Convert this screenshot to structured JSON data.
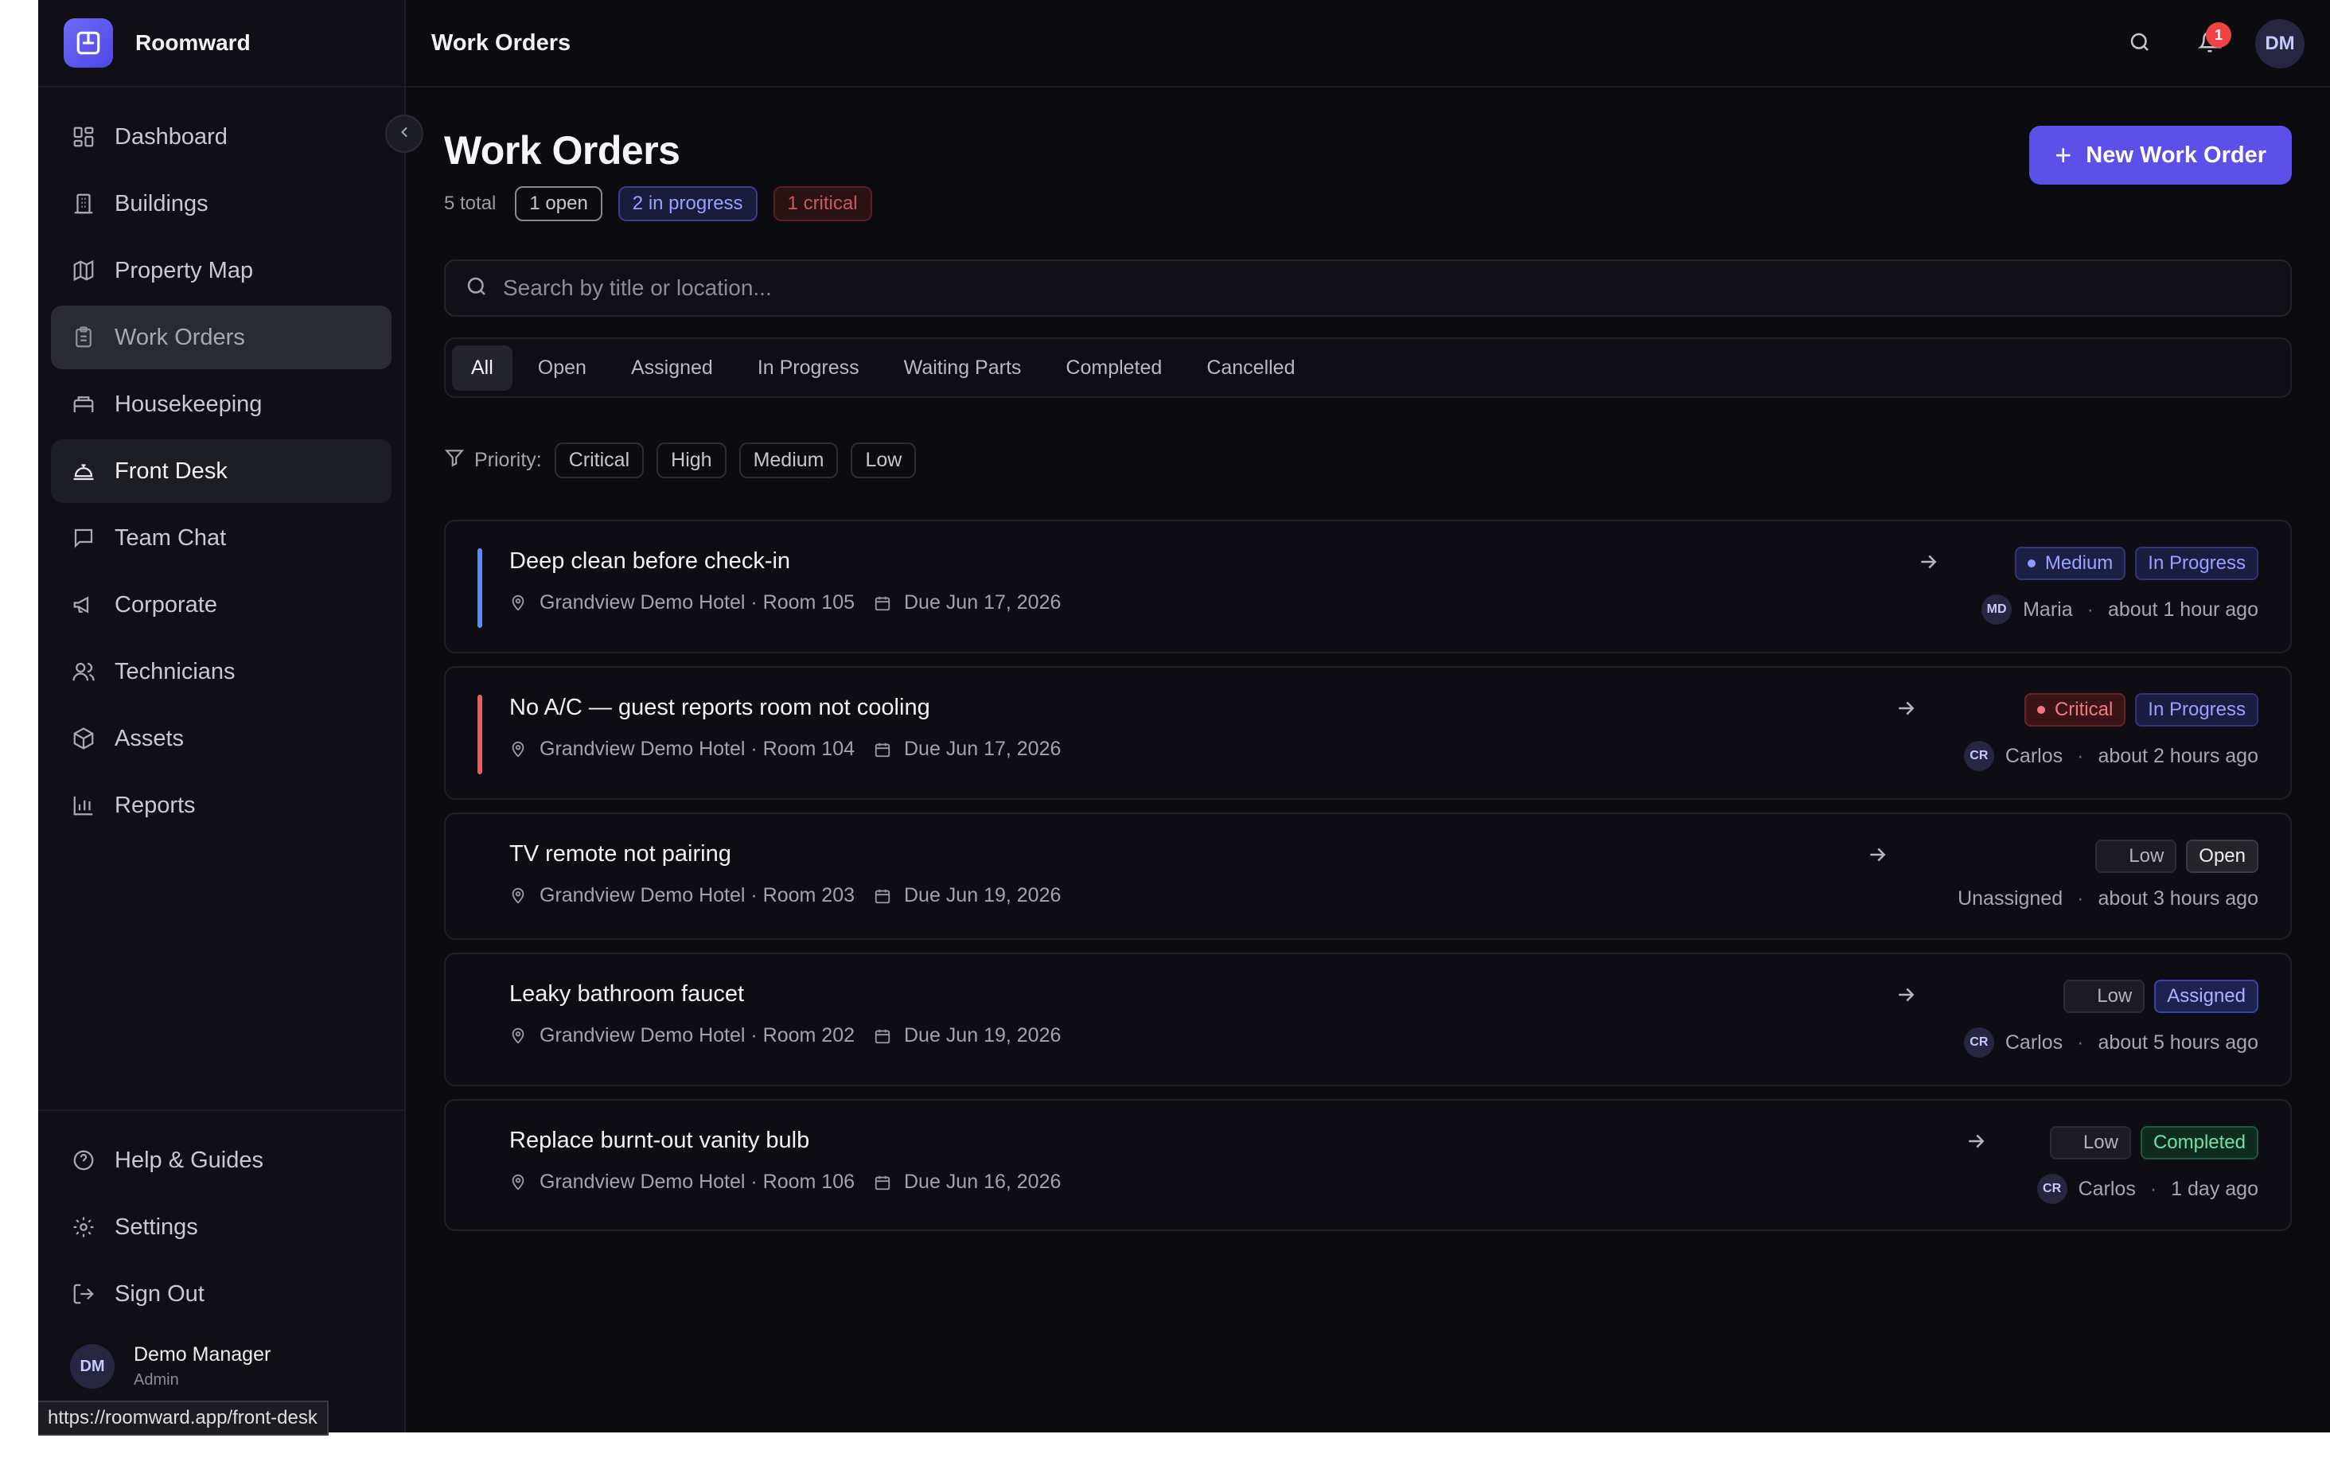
{
  "app": {
    "name": "Roomward"
  },
  "sidebar": {
    "items": [
      {
        "label": "Dashboard",
        "icon": "dashboard-icon"
      },
      {
        "label": "Buildings",
        "icon": "building-icon"
      },
      {
        "label": "Property Map",
        "icon": "map-icon"
      },
      {
        "label": "Work Orders",
        "icon": "clipboard-icon"
      },
      {
        "label": "Housekeeping",
        "icon": "bed-icon"
      },
      {
        "label": "Front Desk",
        "icon": "bell-concierge-icon"
      },
      {
        "label": "Team Chat",
        "icon": "chat-icon"
      },
      {
        "label": "Corporate",
        "icon": "megaphone-icon"
      },
      {
        "label": "Technicians",
        "icon": "users-icon"
      },
      {
        "label": "Assets",
        "icon": "box-icon"
      },
      {
        "label": "Reports",
        "icon": "bar-chart-icon"
      }
    ],
    "bottom": [
      {
        "label": "Help & Guides",
        "icon": "help-icon"
      },
      {
        "label": "Settings",
        "icon": "gear-icon"
      },
      {
        "label": "Sign Out",
        "icon": "sign-out-icon"
      }
    ],
    "user": {
      "initials": "DM",
      "name": "Demo Manager",
      "role": "Admin"
    }
  },
  "status_url": "https://roomward.app/front-desk",
  "topbar": {
    "title": "Work Orders",
    "avatar_initials": "DM",
    "notification_count": "1"
  },
  "page": {
    "title": "Work Orders",
    "total": "5 total",
    "open": "1 open",
    "in_progress": "2 in progress",
    "critical": "1 critical",
    "new_button": "New Work Order",
    "search_placeholder": "Search by title or location..."
  },
  "tabs": [
    "All",
    "Open",
    "Assigned",
    "In Progress",
    "Waiting Parts",
    "Completed",
    "Cancelled"
  ],
  "priority_filter": {
    "label": "Priority:",
    "options": [
      "Critical",
      "High",
      "Medium",
      "Low"
    ]
  },
  "orders": [
    {
      "title": "Deep clean before check-in",
      "location": "Grandview Demo Hotel · Room 105",
      "due": "Due Jun 17, 2026",
      "priority": "Medium",
      "status": "In Progress",
      "assignee_initials": "MD",
      "assignee": "Maria",
      "time": "about 1 hour ago",
      "accent": "#5b8def"
    },
    {
      "title": "No A/C — guest reports room not cooling",
      "location": "Grandview Demo Hotel · Room 104",
      "due": "Due Jun 17, 2026",
      "priority": "Critical",
      "status": "In Progress",
      "assignee_initials": "CR",
      "assignee": "Carlos",
      "time": "about 2 hours ago",
      "accent": "#e06262"
    },
    {
      "title": "TV remote not pairing",
      "location": "Grandview Demo Hotel · Room 203",
      "due": "Due Jun 19, 2026",
      "priority": "Low",
      "status": "Open",
      "assignee_initials": "",
      "assignee": "Unassigned",
      "time": "about 3 hours ago",
      "accent": ""
    },
    {
      "title": "Leaky bathroom faucet",
      "location": "Grandview Demo Hotel · Room 202",
      "due": "Due Jun 19, 2026",
      "priority": "Low",
      "status": "Assigned",
      "assignee_initials": "CR",
      "assignee": "Carlos",
      "time": "about 5 hours ago",
      "accent": ""
    },
    {
      "title": "Replace burnt-out vanity bulb",
      "location": "Grandview Demo Hotel · Room 106",
      "due": "Due Jun 16, 2026",
      "priority": "Low",
      "status": "Completed",
      "assignee_initials": "CR",
      "assignee": "Carlos",
      "time": "1 day ago",
      "accent": ""
    }
  ],
  "colors": {
    "accent": "#5b50e8",
    "background": "#0b0b10",
    "sidebar": "#0f0f15"
  }
}
